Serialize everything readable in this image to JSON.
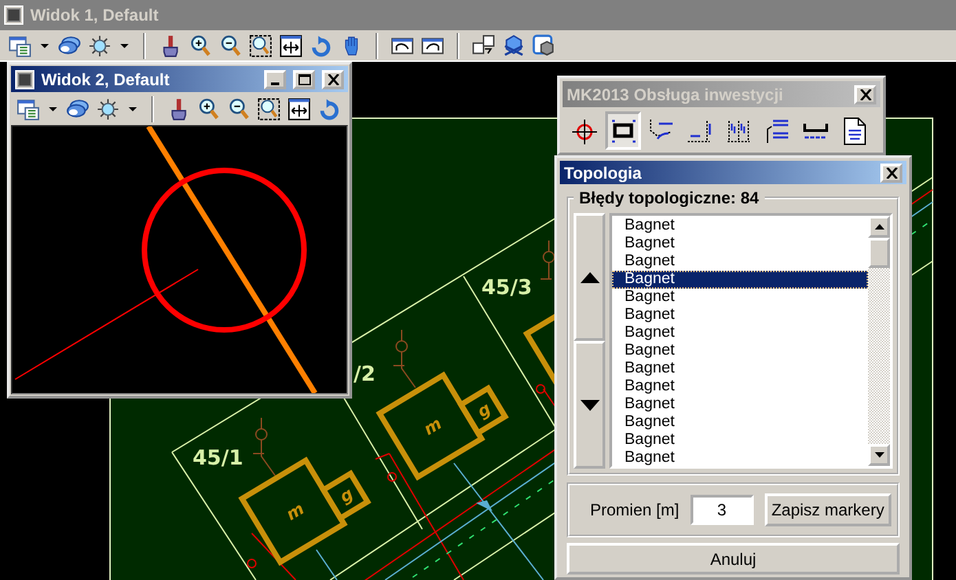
{
  "main_window": {
    "title": "Widok 1, Default",
    "active": false
  },
  "view_window": {
    "title": "Widok 2, Default",
    "active": true
  },
  "map": {
    "parcel_labels": [
      "45/1",
      "/2",
      "45/3"
    ],
    "buildings": [
      {
        "main": "m",
        "annex": "g"
      },
      {
        "main": "m",
        "annex": "g"
      }
    ]
  },
  "palette": {
    "title": "MK2013 Obsługa inwestycji",
    "active": false,
    "tools": [
      {
        "selected": false
      },
      {
        "selected": true
      },
      {
        "selected": false
      },
      {
        "selected": false
      },
      {
        "selected": false
      },
      {
        "selected": false
      },
      {
        "selected": false
      },
      {
        "selected": false
      }
    ]
  },
  "dialog": {
    "title": "Topologia",
    "active": true,
    "group_title": "Błędy topologiczne: 84",
    "items": [
      {
        "text": "Bagnet",
        "selected": false
      },
      {
        "text": "Bagnet",
        "selected": false
      },
      {
        "text": "Bagnet",
        "selected": false
      },
      {
        "text": "Bagnet",
        "selected": true
      },
      {
        "text": "Bagnet",
        "selected": false
      },
      {
        "text": "Bagnet",
        "selected": false
      },
      {
        "text": "Bagnet",
        "selected": false
      },
      {
        "text": "Bagnet",
        "selected": false
      },
      {
        "text": "Bagnet",
        "selected": false
      },
      {
        "text": "Bagnet",
        "selected": false
      },
      {
        "text": "Bagnet",
        "selected": false
      },
      {
        "text": "Bagnet",
        "selected": false
      },
      {
        "text": "Bagnet",
        "selected": false
      },
      {
        "text": "Bagnet",
        "selected": false
      }
    ],
    "radius_label": "Promien [m]",
    "radius_value": "3",
    "save_button": "Zapisz markery",
    "cancel_button": "Anuluj"
  }
}
